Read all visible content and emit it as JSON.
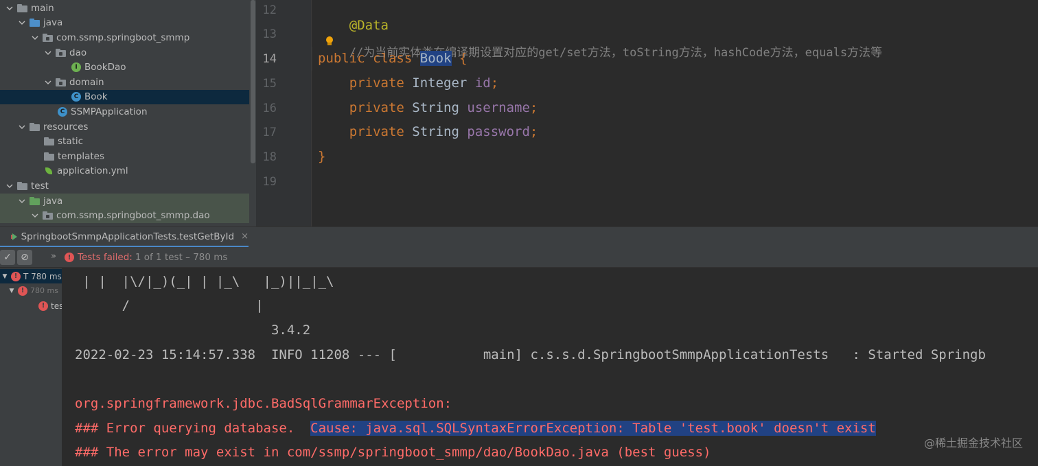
{
  "project_tree": {
    "items": [
      {
        "label": "main",
        "icon": "folder-icon",
        "expanded": true
      },
      {
        "label": "java",
        "icon": "source-folder-icon",
        "expanded": true
      },
      {
        "label": "com.ssmp.springboot_smmp",
        "icon": "package-icon",
        "expanded": true
      },
      {
        "label": "dao",
        "icon": "package-icon",
        "expanded": true
      },
      {
        "label": "BookDao",
        "icon": "interface-icon"
      },
      {
        "label": "domain",
        "icon": "package-icon",
        "expanded": true
      },
      {
        "label": "Book",
        "icon": "class-icon",
        "selected": true
      },
      {
        "label": "SSMPApplication",
        "icon": "spring-class-icon"
      },
      {
        "label": "resources",
        "icon": "resources-folder-icon",
        "expanded": true
      },
      {
        "label": "static",
        "icon": "folder-icon"
      },
      {
        "label": "templates",
        "icon": "folder-icon"
      },
      {
        "label": "application.yml",
        "icon": "yaml-file-icon"
      },
      {
        "label": "test",
        "icon": "folder-icon",
        "expanded": true
      },
      {
        "label": "java",
        "icon": "test-source-folder-icon",
        "expanded": true
      },
      {
        "label": "com.ssmp.springboot_smmp.dao",
        "icon": "package-icon",
        "expanded": true
      }
    ]
  },
  "editor": {
    "line_numbers": [
      "12",
      "13",
      "14",
      "15",
      "16",
      "17",
      "18",
      "19"
    ],
    "current_line": "14",
    "line12": {
      "annotation": "@Data"
    },
    "line13": {
      "comment_prefix": "//",
      "comment_text": "为当前实体类在编译期设置对应的get/set方法，toString方法，hashCode方法，equals方法等"
    },
    "line14": {
      "kw1": "public",
      "kw2": "class",
      "class_name": "Book",
      "brace": "{"
    },
    "fields": [
      {
        "modifier": "private",
        "type": "Integer",
        "name": "id",
        "semi": ";"
      },
      {
        "modifier": "private",
        "type": "String",
        "name": "username",
        "semi": ";"
      },
      {
        "modifier": "private",
        "type": "String",
        "name": "password",
        "semi": ";"
      }
    ],
    "line18": {
      "brace": "}"
    }
  },
  "run_window": {
    "tab_label": "SpringbootSmmpApplicationTests.testGetById",
    "tab_close": "×",
    "toolbar": {
      "show_passed_icon": "✓",
      "show_ignored_icon": "⊘",
      "more_icon": "»",
      "status_failed": "Tests failed:",
      "status_rest": "1 of 1 test – 780 ms"
    },
    "test_tree": [
      {
        "label": "T 780 ms",
        "status": "failed"
      },
      {
        "label": "780 ms",
        "status": "failed"
      },
      {
        "label": "tes",
        "status": "failed"
      }
    ],
    "console": {
      "banner1": " | |  |\\/|_)(_| | |_\\   |_)||_|_\\",
      "banner2": "      /                |",
      "version": "                         3.4.2",
      "log": "2022-02-23 15:14:57.338  INFO 11208 --- [           main] c.s.s.d.SpringbootSmmpApplicationTests   : Started Springb",
      "exception": "org.springframework.jdbc.BadSqlGrammarException:",
      "error_query_prefix": "### Error querying database.  ",
      "error_query_cause": "Cause: java.sql.SQLSyntaxErrorException: Table 'test.book' doesn't exist",
      "error_may_exist": "### The error may exist in com/ssmp/springboot_smmp/dao/BookDao.java (best guess)"
    }
  },
  "watermark": "@稀土掘金技术社区",
  "colors": {
    "keyword": "#cc7832",
    "annotation": "#bbb529",
    "field": "#9876aa",
    "error_text": "#ff6b68",
    "selection": "#214283"
  }
}
